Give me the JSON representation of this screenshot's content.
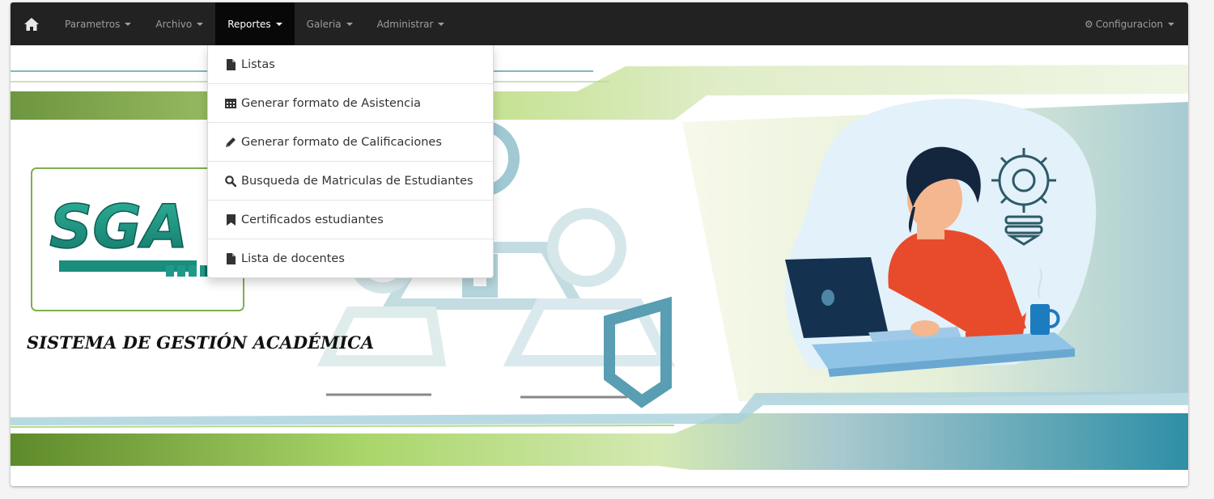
{
  "navbar": {
    "home_icon": "home-icon",
    "items": [
      {
        "label": "Parametros"
      },
      {
        "label": "Archivo"
      },
      {
        "label": "Reportes",
        "active": true
      },
      {
        "label": "Galeria"
      },
      {
        "label": "Administrar"
      }
    ],
    "config": {
      "label": "Configuracion",
      "icon": "gear-icon"
    }
  },
  "dropdown": {
    "items": [
      {
        "label": "Listas",
        "icon": "file-icon"
      },
      {
        "label": "Generar formato de Asistencia",
        "icon": "calendar-icon"
      },
      {
        "label": "Generar formato de Calificaciones",
        "icon": "pencil-icon"
      },
      {
        "label": "Busqueda de Matriculas de Estudiantes",
        "icon": "search-icon"
      },
      {
        "label": "Certificados estudiantes",
        "icon": "bookmark-icon"
      },
      {
        "label": "Lista de docentes",
        "icon": "file-icon"
      }
    ]
  },
  "banner": {
    "logo_text": "SGA",
    "system_title": "SISTEMA DE GESTIÓN ACADÉMICA"
  },
  "colors": {
    "navbar_bg": "#222222",
    "navbar_active_bg": "#080808",
    "accent_green": "#8cc63f",
    "accent_teal": "#2e8fa6",
    "logo_teal": "#1f9a8a"
  }
}
